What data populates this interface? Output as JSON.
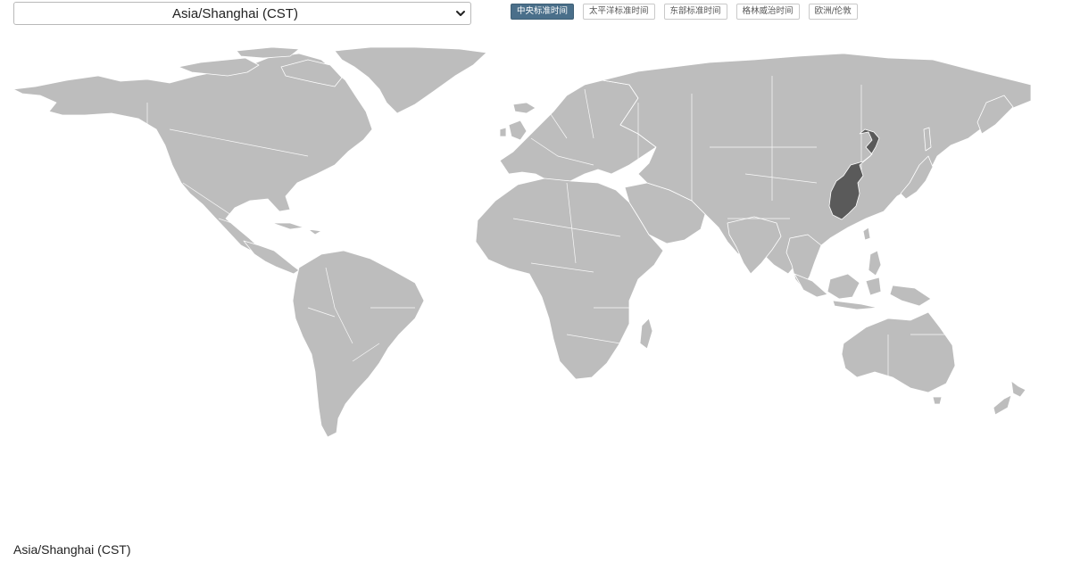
{
  "timezone_select": {
    "selected": "Asia/Shanghai (CST)",
    "chevron_icon": "chevron-down-icon"
  },
  "quick_buttons": [
    {
      "label": "中央标准时间",
      "active": true
    },
    {
      "label": "太平洋标准时间",
      "active": false
    },
    {
      "label": "东部标准时间",
      "active": false
    },
    {
      "label": "格林威治时间",
      "active": false
    },
    {
      "label": "欧洲/伦敦",
      "active": false
    }
  ],
  "map": {
    "land_color": "#bdbdbd",
    "highlight_color": "#5a5a5a",
    "highlighted_region": "east-china"
  },
  "footer": {
    "label": "Asia/Shanghai (CST)"
  },
  "colors": {
    "active_button": "#4a6f8a"
  }
}
